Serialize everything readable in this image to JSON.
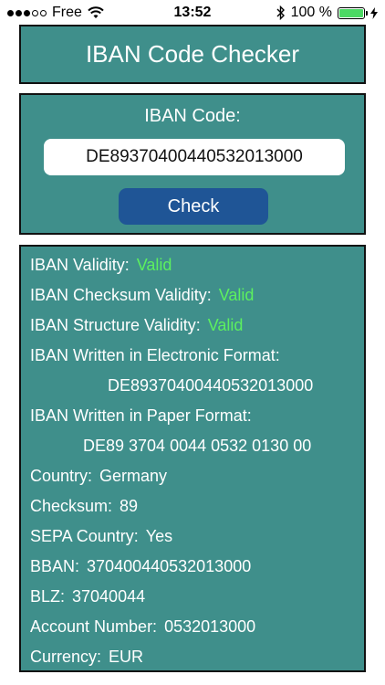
{
  "status_bar": {
    "carrier": "Free",
    "time": "13:52",
    "battery_percent": "100 %",
    "battery_level": 1.0,
    "icons": [
      "signal-dots-icon",
      "wifi-icon",
      "bluetooth-icon",
      "battery-icon",
      "charging-bolt-icon"
    ]
  },
  "header": {
    "title": "IBAN Code Checker"
  },
  "input_section": {
    "label": "IBAN Code:",
    "value": "DE89370400440532013000",
    "check_label": "Check"
  },
  "colors": {
    "panel": "#3f8f8b",
    "button": "#1f5596",
    "valid": "#5cf05f"
  },
  "results": {
    "iban_validity": {
      "label": "IBAN Validity:",
      "value": "Valid"
    },
    "checksum_validity": {
      "label": "IBAN Checksum Validity:",
      "value": "Valid"
    },
    "structure_validity": {
      "label": "IBAN Structure Validity:",
      "value": "Valid"
    },
    "electronic_format": {
      "label": "IBAN Written in Electronic Format:",
      "value": "DE89370400440532013000"
    },
    "paper_format": {
      "label": "IBAN Written in Paper Format:",
      "value": "DE89 3704 0044 0532 0130 00"
    },
    "country": {
      "label": "Country:",
      "value": "Germany"
    },
    "checksum": {
      "label": "Checksum:",
      "value": "89"
    },
    "sepa_country": {
      "label": "SEPA Country:",
      "value": "Yes"
    },
    "bban": {
      "label": "BBAN:",
      "value": "370400440532013000"
    },
    "blz": {
      "label": "BLZ:",
      "value": "37040044"
    },
    "account_number": {
      "label": "Account Number:",
      "value": "0532013000"
    },
    "currency": {
      "label": "Currency:",
      "value": "EUR"
    }
  }
}
